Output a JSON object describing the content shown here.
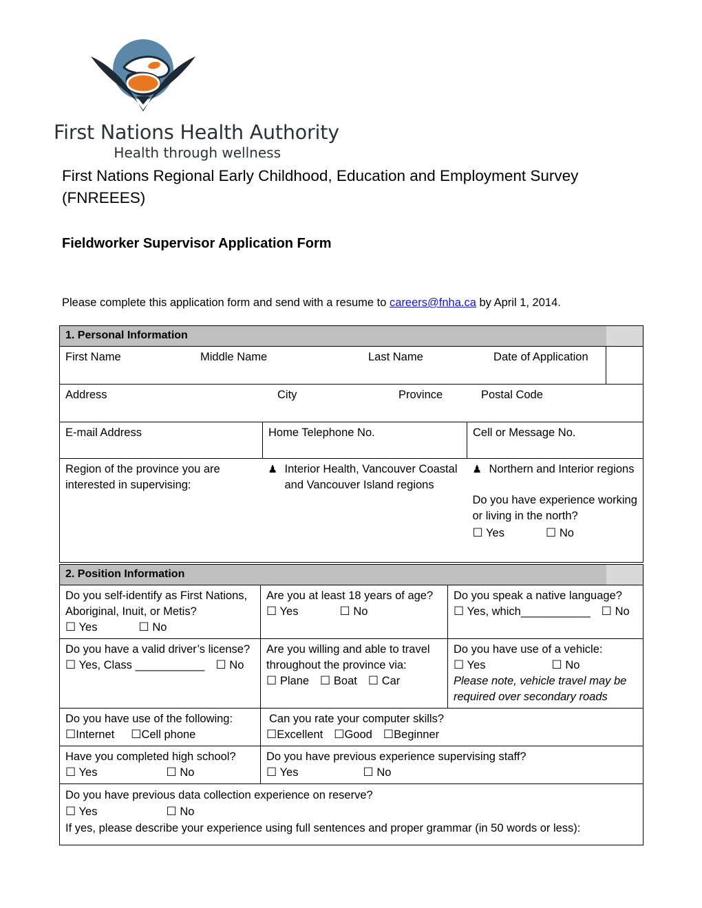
{
  "logo": {
    "name": "First Nations Health Authority",
    "tagline": "Health through wellness",
    "colors": {
      "circle": "#5b87a8",
      "raven": "#1d2a35",
      "accent": "#e87722"
    }
  },
  "document": {
    "title": "First Nations Regional Early Childhood, Education and Employment Survey (FNREEES)",
    "subtitle": "Fieldworker Supervisor Application Form",
    "instruction_before": "Please complete this application form and send with a resume to ",
    "instruction_email": "careers@fnha.ca",
    "instruction_after": "  by April 1, 2014."
  },
  "section1": {
    "heading": "1. Personal Information",
    "row_names": {
      "first_name": "First Name",
      "middle_name": "Middle Name",
      "last_name": "Last Name",
      "date_of_application": "Date of Application"
    },
    "row_address": {
      "address": "Address",
      "city": "City",
      "province": "Province",
      "postal_code": "Postal Code"
    },
    "row_contact": {
      "email": "E-mail Address",
      "home_phone": "Home Telephone No.",
      "cell": "Cell or Message No."
    },
    "row_region": {
      "prompt": "Region of the province you are interested in supervising:",
      "option1": "Interior Health, Vancouver Coastal and Vancouver Island regions",
      "option2": "Northern and Interior regions",
      "north_question": "Do you have experience working or living in the north?",
      "yes": "Yes",
      "no": "No"
    }
  },
  "section2": {
    "heading": "2. Position Information",
    "q_identify": {
      "text": "Do you self-identify as First Nations, Aboriginal, Inuit, or Metis?",
      "yes": "Yes",
      "no": "No"
    },
    "q_age": {
      "text": "Are you at least 18 years of age?",
      "yes": "Yes",
      "no": "No"
    },
    "q_language": {
      "text": "Do you speak a native language?",
      "yes": "Yes, which",
      "blank": "___________",
      "no": "No"
    },
    "q_license": {
      "text": "Do you have a valid driver’s license?",
      "yes": "Yes, Class",
      "blank": "___________",
      "no": "No"
    },
    "q_travel": {
      "text": "Are you willing and able to travel throughout the province via:",
      "plane": "Plane",
      "boat": "Boat",
      "car": "Car"
    },
    "q_vehicle": {
      "text": "Do you have use of a vehicle:",
      "yes": "Yes",
      "no": "No",
      "note": "Please note, vehicle travel may be required over secondary roads"
    },
    "q_following": {
      "text": "Do you have use of the following:",
      "internet": "Internet",
      "cell_phone": "Cell phone"
    },
    "q_computer": {
      "text": "Can you rate your computer skills?",
      "excellent": "Excellent",
      "good": "Good",
      "beginner": "Beginner"
    },
    "q_highschool": {
      "text": "Have you completed high school?",
      "yes": "Yes",
      "no": "No"
    },
    "q_supervising": {
      "text": "Do you have previous experience supervising staff?",
      "yes": "Yes",
      "no": "No"
    },
    "q_datacollection": {
      "text": "Do you have previous data collection experience on reserve?",
      "yes": "Yes",
      "no": "No",
      "followup": "If yes, please describe your experience using full sentences and proper grammar (in 50 words or less):"
    }
  },
  "glyphs": {
    "checkbox": "☐",
    "bullet": "♟"
  }
}
